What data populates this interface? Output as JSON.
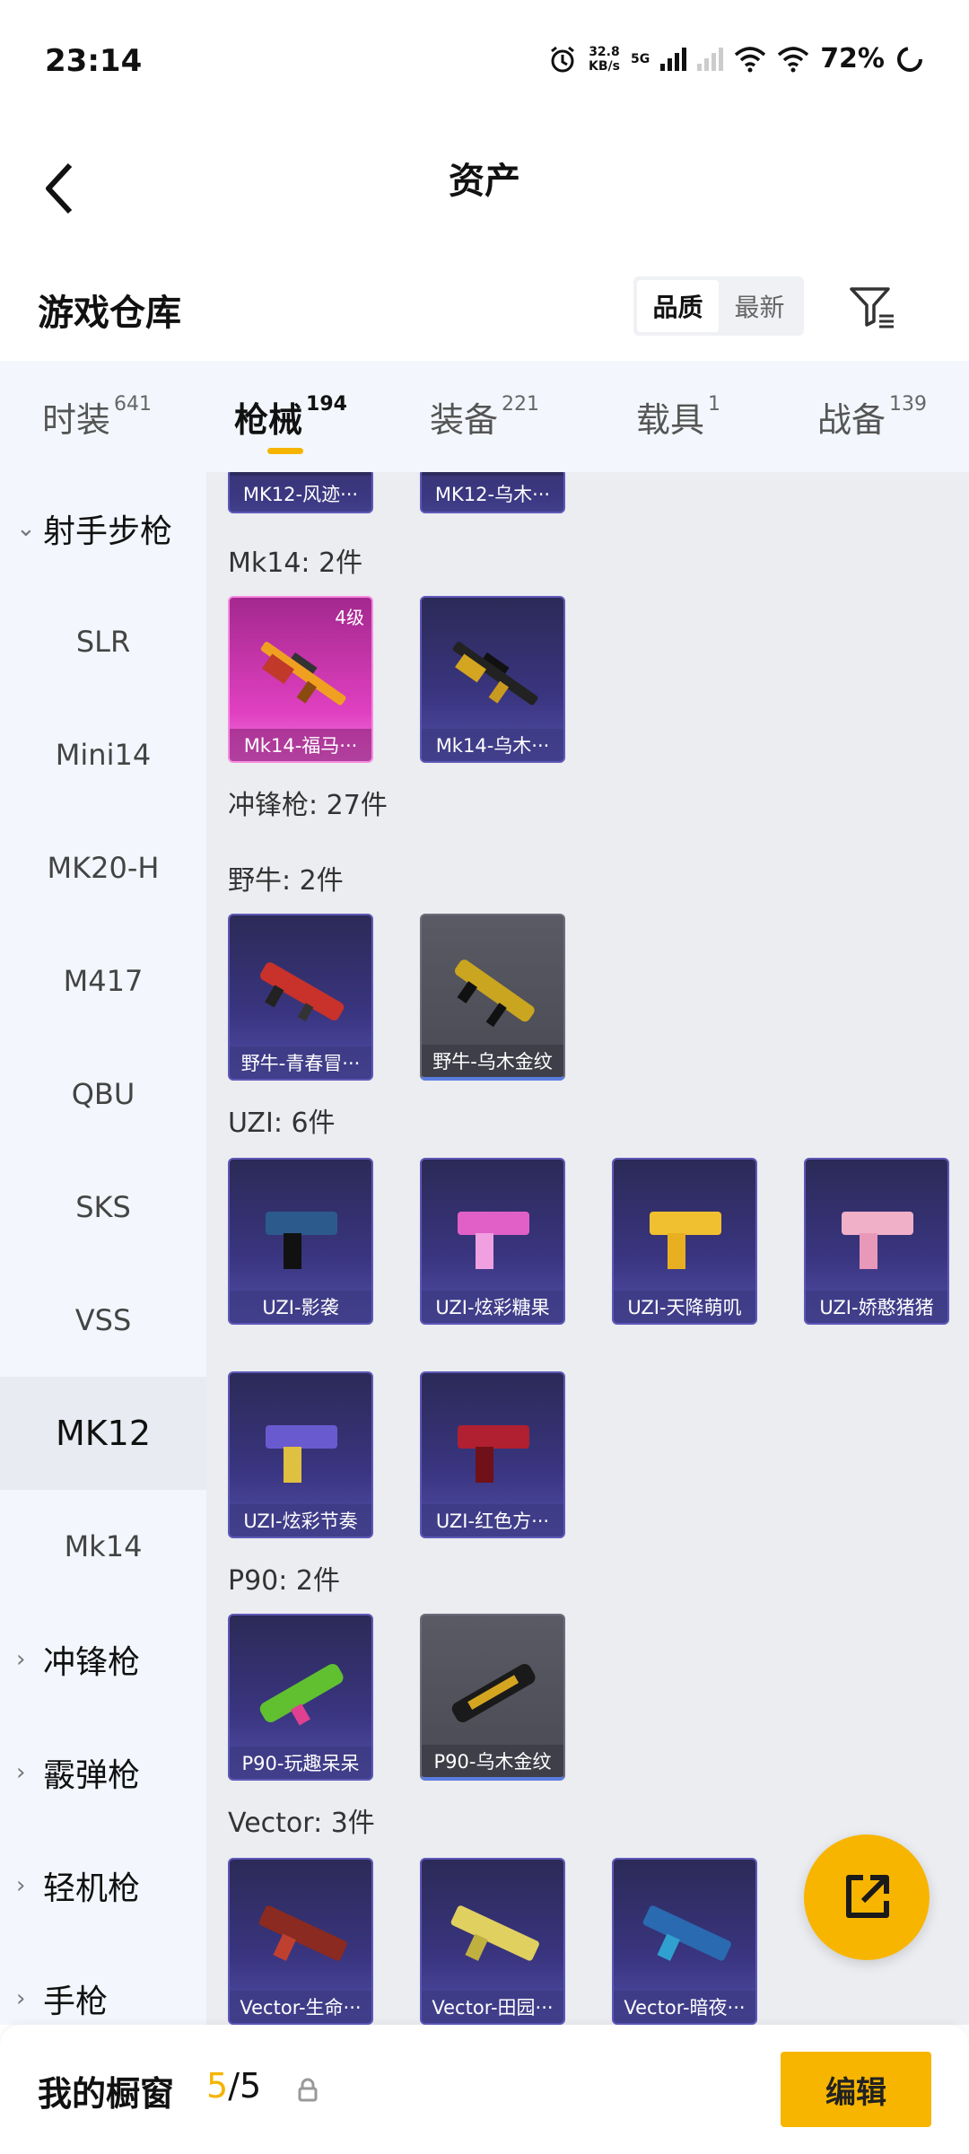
{
  "status_bar": {
    "time": "23:14",
    "net_speed_value": "32.8",
    "net_speed_unit": "KB/s",
    "network": "5G",
    "battery": "72%"
  },
  "header": {
    "title": "资产",
    "back_icon": "chevron-left-icon"
  },
  "warehouse": {
    "title": "游戏仓库",
    "sort_options": [
      "品质",
      "最新"
    ],
    "active_sort": "品质",
    "filter_icon": "filter-icon"
  },
  "tabs": [
    {
      "label": "时装",
      "count": "641"
    },
    {
      "label": "枪械",
      "count": "194",
      "active": true
    },
    {
      "label": "装备",
      "count": "221"
    },
    {
      "label": "载具",
      "count": "1"
    },
    {
      "label": "战备",
      "count": "139"
    }
  ],
  "sidebar": {
    "group_open": "射手步枪",
    "items": [
      "SLR",
      "Mini14",
      "MK20-H",
      "M417",
      "QBU",
      "SKS",
      "VSS",
      "MK12",
      "Mk14"
    ],
    "active_item": "MK12",
    "groups_collapsed": [
      "冲锋枪",
      "霰弹枪",
      "轻机枪",
      "手枪"
    ]
  },
  "content": {
    "top_partial": [
      "MK12-风迹···",
      "MK12-乌木···"
    ],
    "sections": [
      {
        "label": "Mk14: 2件",
        "items": [
          {
            "name": "Mk14-福马···",
            "level": "4级",
            "style": "pink"
          },
          {
            "name": "Mk14-乌木···",
            "style": "purple"
          }
        ]
      },
      {
        "label": "冲锋枪: 27件"
      },
      {
        "label": "野牛: 2件",
        "items": [
          {
            "name": "野牛-青春冒···",
            "style": "purple"
          },
          {
            "name": "野牛-乌木金纹",
            "style": "grey"
          }
        ]
      },
      {
        "label": "UZI: 6件",
        "items": [
          {
            "name": "UZI-影袭",
            "style": "purple"
          },
          {
            "name": "UZI-炫彩糖果",
            "style": "purple"
          },
          {
            "name": "UZI-天降萌叽",
            "style": "purple"
          },
          {
            "name": "UZI-娇憨猪猪",
            "style": "purple"
          },
          {
            "name": "UZI-炫彩节奏",
            "style": "purple"
          },
          {
            "name": "UZI-红色方···",
            "style": "purple"
          }
        ]
      },
      {
        "label": "P90: 2件",
        "items": [
          {
            "name": "P90-玩趣呆呆",
            "style": "purple"
          },
          {
            "name": "P90-乌木金纹",
            "style": "grey"
          }
        ]
      },
      {
        "label": "Vector: 3件",
        "items": [
          {
            "name": "Vector-生命···",
            "style": "purple"
          },
          {
            "name": "Vector-田园···",
            "style": "purple"
          },
          {
            "name": "Vector-暗夜···",
            "style": "purple"
          }
        ]
      }
    ]
  },
  "fab": {
    "icon": "share-icon"
  },
  "bottom_bar": {
    "title": "我的橱窗",
    "count_current": "5",
    "count_sep": "/",
    "count_total": "5",
    "lock_icon": "lock-icon",
    "edit_label": "编辑"
  },
  "colors": {
    "accent": "#f7b500",
    "purple_card": "#3a3580",
    "pink_card": "#e040c0"
  }
}
